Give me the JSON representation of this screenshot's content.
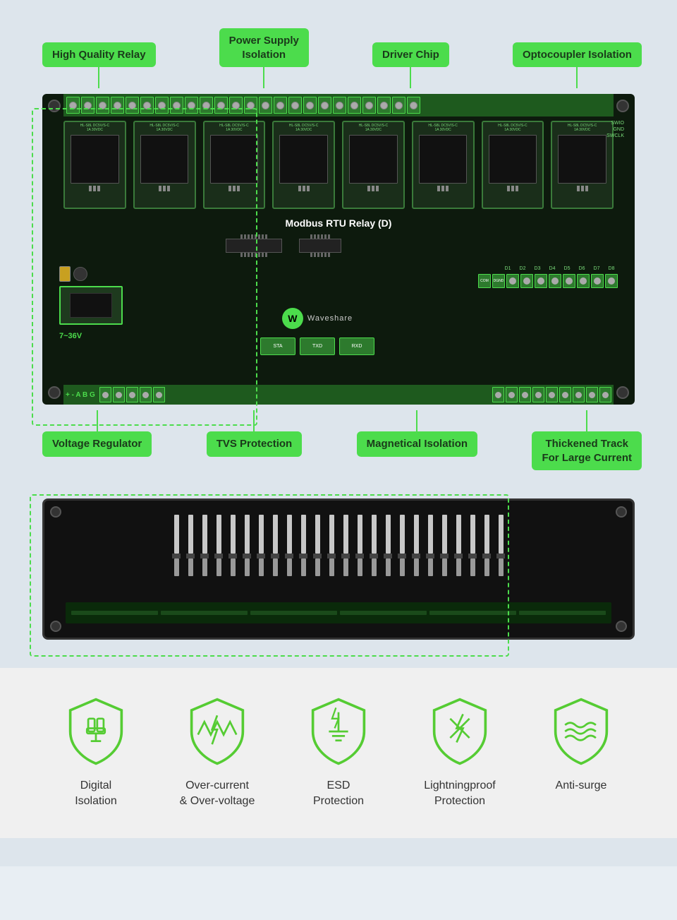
{
  "page": {
    "background": "#dde5ec"
  },
  "top_labels": [
    {
      "id": "high-quality-relay",
      "text": "High Quality Relay"
    },
    {
      "id": "power-supply-isolation",
      "text": "Power Supply\nIsolation"
    },
    {
      "id": "driver-chip",
      "text": "Driver Chip"
    },
    {
      "id": "optocoupler-isolation",
      "text": "Optocoupler Isolation"
    }
  ],
  "bottom_labels": [
    {
      "id": "voltage-regulator",
      "text": "Voltage Regulator"
    },
    {
      "id": "tvs-protection",
      "text": "TVS Protection"
    },
    {
      "id": "magnetical-isolation",
      "text": "Magnetical Isolation"
    },
    {
      "id": "thickened-track",
      "text": "Thickened Track\nFor Large Current"
    }
  ],
  "board": {
    "title": "Modbus RTU Relay (D)",
    "voltage": "7~36V",
    "brand": "Waveshare"
  },
  "features": [
    {
      "id": "digital-isolation",
      "label": "Digital\nIsolation",
      "icon": "digital-isolation-icon"
    },
    {
      "id": "over-current-voltage",
      "label": "Over-current\n& Over-voltage",
      "icon": "over-current-icon"
    },
    {
      "id": "esd-protection",
      "label": "ESD\nProtection",
      "icon": "esd-icon"
    },
    {
      "id": "lightningproof",
      "label": "Lightningproof\nProtection",
      "icon": "lightningproof-icon"
    },
    {
      "id": "anti-surge",
      "label": "Anti-surge",
      "icon": "anti-surge-icon"
    }
  ]
}
